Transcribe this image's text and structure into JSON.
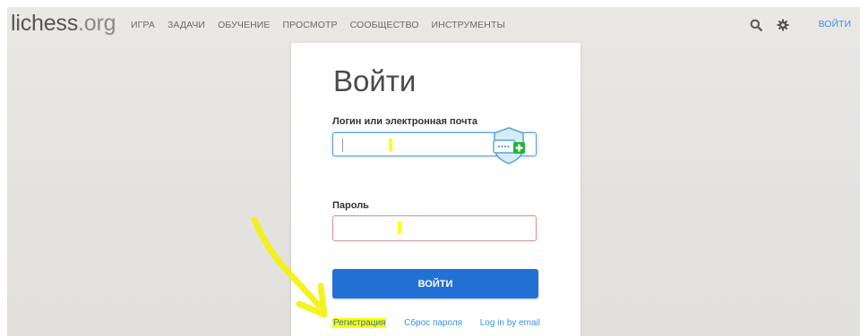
{
  "header": {
    "logo_main": "lichess",
    "logo_tld": ".org",
    "nav": [
      "ИГРА",
      "ЗАДАЧИ",
      "ОБУЧЕНИЕ",
      "ПРОСМОТР",
      "СООБЩЕСТВО",
      "ИНСТРУМЕНТЫ"
    ],
    "login_link": "ВОЙТИ",
    "icons": [
      "search-icon",
      "gear-icon"
    ]
  },
  "form": {
    "title": "Войти",
    "username_label": "Логин или электронная почта",
    "username_value": "",
    "password_label": "Пароль",
    "password_value": "",
    "submit_label": "ВОЙТИ"
  },
  "footer_links": {
    "register": "Регистрация",
    "reset_password": "Сброс пароля",
    "email_login": "Log in by email"
  },
  "colors": {
    "accent": "#3893e8",
    "button": "#2272d6",
    "highlight": "#ffff00",
    "annotation_arrow": "#f4f40a"
  }
}
